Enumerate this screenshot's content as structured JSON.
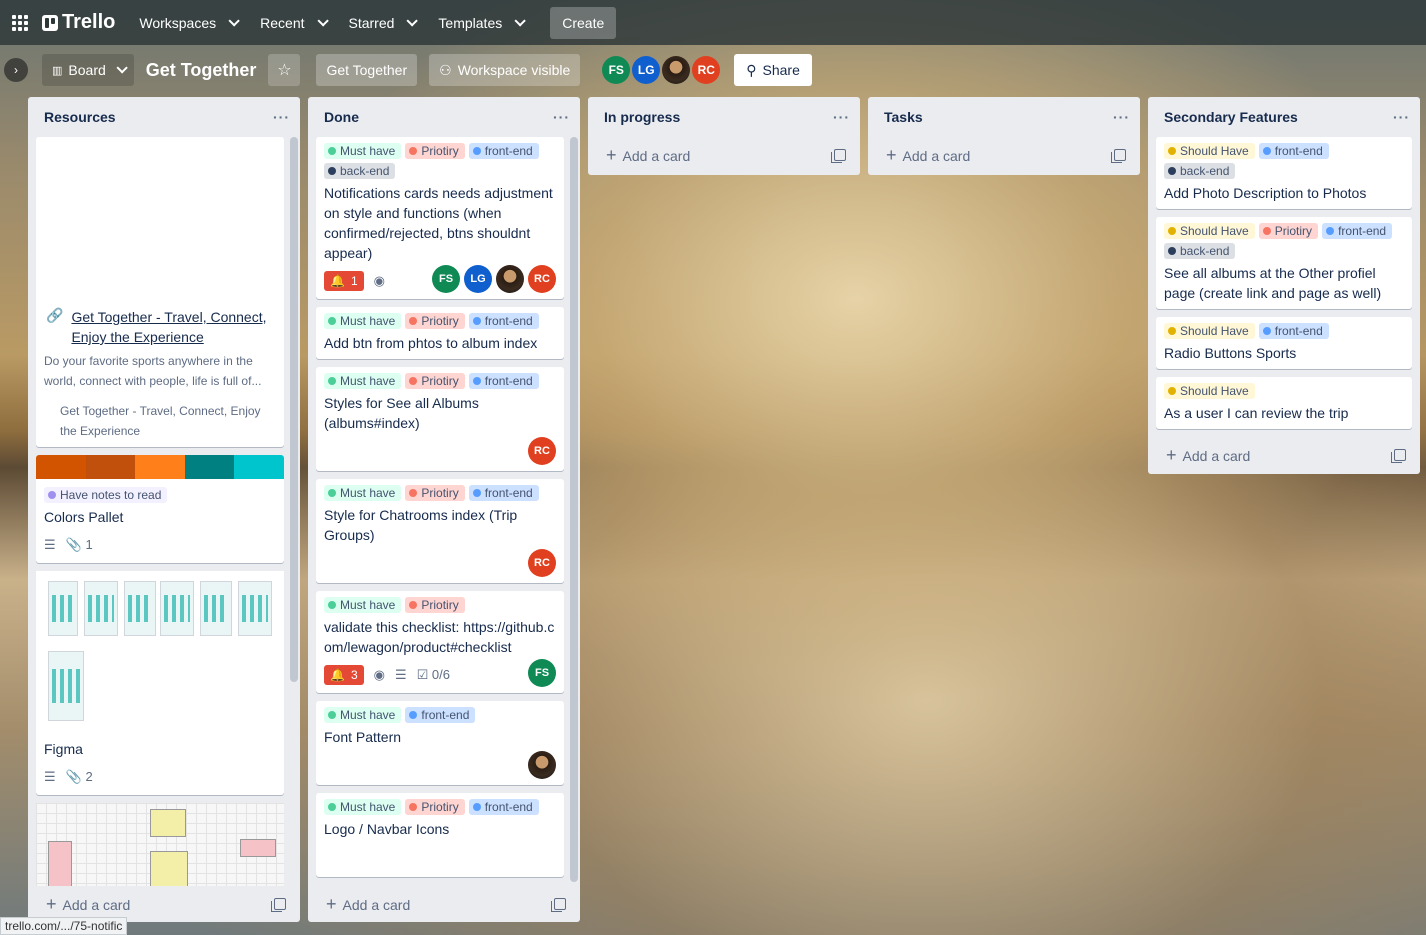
{
  "topnav": {
    "logo": "Trello",
    "workspaces": "Workspaces",
    "recent": "Recent",
    "starred": "Starred",
    "templates": "Templates",
    "create": "Create"
  },
  "board": {
    "view": "Board",
    "title": "Get Together",
    "workspace": "Get Together",
    "visibility": "Workspace visible",
    "share": "Share",
    "members": [
      "FS",
      "LG",
      "",
      "RC"
    ]
  },
  "lists": {
    "resources": {
      "title": "Resources",
      "link_card": {
        "title": "Get Together - Travel, Connect, Enjoy the Experience",
        "desc": "Do your favorite sports anywhere in the world, connect with people, life is full of...",
        "source": "Get Together - Travel, Connect, Enjoy the Experience"
      },
      "colors_card": {
        "label": "Have notes to read",
        "title": "Colors Pallet",
        "attachments": "1",
        "palette": [
          "#d35400",
          "#c0500b",
          "#ff7f1a",
          "#008080",
          "#00c5cc"
        ]
      },
      "figma_card": {
        "title": "Figma",
        "attachments": "2"
      },
      "add_card": "Add a card"
    },
    "done": {
      "title": "Done",
      "cards": [
        {
          "labels": [
            "Must have",
            "Priotiry",
            "front-end",
            "back-end"
          ],
          "title": "Notifications cards needs adjustment on style and functions (when confirmed/rejected, btns shouldnt appear)",
          "notifications": "1",
          "members": [
            "FS",
            "LG",
            "",
            "RC"
          ]
        },
        {
          "labels": [
            "Must have",
            "Priotiry",
            "front-end"
          ],
          "title": "Add btn from phtos to album index"
        },
        {
          "labels": [
            "Must have",
            "Priotiry",
            "front-end"
          ],
          "title": "Styles for See all Albums (albums#index)",
          "members": [
            "RC"
          ]
        },
        {
          "labels": [
            "Must have",
            "Priotiry",
            "front-end"
          ],
          "title": "Style for Chatrooms index (Trip Groups)",
          "members": [
            "RC"
          ]
        },
        {
          "labels": [
            "Must have",
            "Priotiry"
          ],
          "title": "validate this checklist: https://github.com/lewagon/product#checklist",
          "notifications": "3",
          "checklist": "0/6",
          "members": [
            "FS"
          ]
        },
        {
          "labels": [
            "Must have",
            "front-end"
          ],
          "title": "Font Pattern"
        },
        {
          "labels": [
            "Must have",
            "Priotiry",
            "front-end"
          ],
          "title": "Logo / Navbar Icons"
        }
      ],
      "add_card": "Add a card"
    },
    "in_progress": {
      "title": "In progress",
      "add_card": "Add a card"
    },
    "tasks": {
      "title": "Tasks",
      "add_card": "Add a card"
    },
    "secondary": {
      "title": "Secondary Features",
      "cards": [
        {
          "labels": [
            "Should Have",
            "front-end",
            "back-end"
          ],
          "title": "Add Photo Description to Photos"
        },
        {
          "labels": [
            "Should Have",
            "Priotiry",
            "front-end",
            "back-end"
          ],
          "title": "See all albums at the Other profiel page (create link and page as well)"
        },
        {
          "labels": [
            "Should Have",
            "front-end"
          ],
          "title": "Radio Buttons Sports"
        },
        {
          "labels": [
            "Should Have"
          ],
          "title": "As a user I can review the trip"
        }
      ],
      "add_card": "Add a card"
    }
  },
  "status_url": "trello.com/.../75-notific"
}
